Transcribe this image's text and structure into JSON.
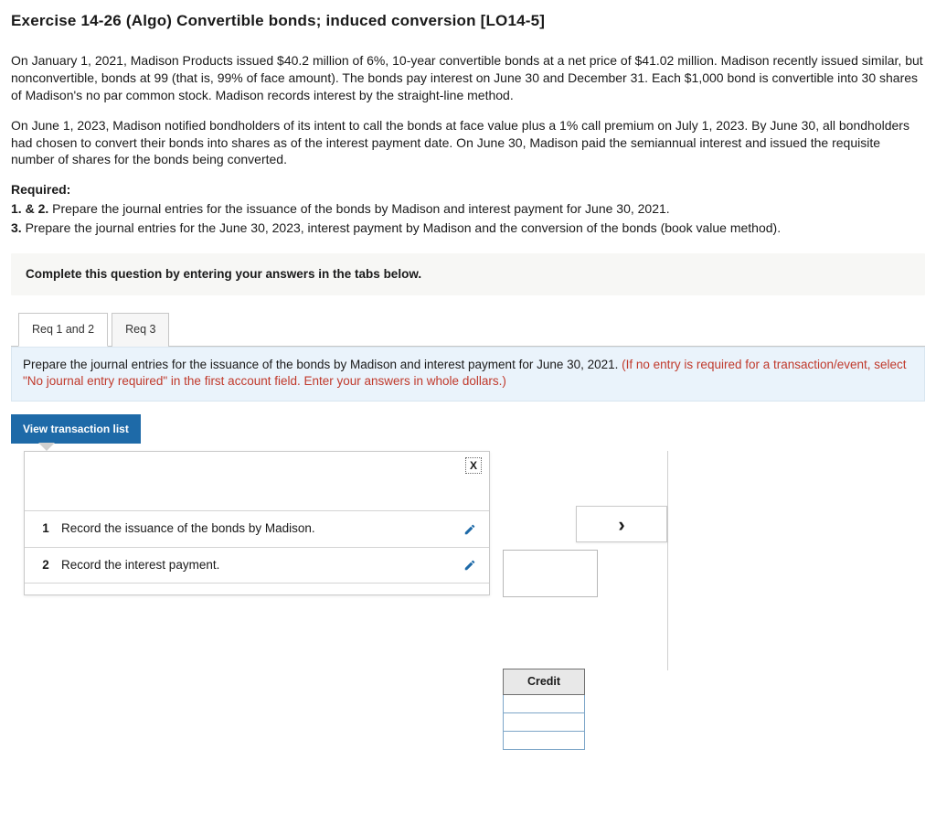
{
  "title": "Exercise 14-26 (Algo) Convertible bonds; induced conversion [LO14-5]",
  "para1": "On January 1, 2021, Madison Products issued $40.2 million of 6%, 10-year convertible bonds at a net price of $41.02 million. Madison recently issued similar, but nonconvertible, bonds at 99 (that is, 99% of face amount). The bonds pay interest on June 30 and December 31. Each $1,000 bond is convertible into 30 shares of Madison's no par common stock. Madison records interest by the straight-line method.",
  "para2": "On June 1, 2023, Madison notified bondholders of its intent to call the bonds at face value plus a 1% call premium on July 1, 2023. By June 30, all bondholders had chosen to convert their bonds into shares as of the interest payment date. On June 30, Madison paid the semiannual interest and issued the requisite number of shares for the bonds being converted.",
  "required": {
    "label": "Required:",
    "line1_prefix": "1. & 2. ",
    "line1_text": "Prepare the journal entries for the issuance of the bonds by Madison and interest payment for June 30, 2021.",
    "line2_prefix": "3. ",
    "line2_text": "Prepare the journal entries for the June 30, 2023, interest payment by Madison and the conversion of the bonds (book value method)."
  },
  "instruction_bar": "Complete this question by entering your answers in the tabs below.",
  "tabs": {
    "t1": "Req 1 and 2",
    "t2": "Req 3"
  },
  "tab_note": {
    "black": "Prepare the journal entries for the issuance of the bonds by Madison and interest payment for June 30, 2021. ",
    "red": "(If no entry is required for a transaction/event, select \"No journal entry required\" in the first account field. Enter your answers in whole dollars.)"
  },
  "view_btn": "View transaction list",
  "close_x": "X",
  "trans": [
    {
      "n": "1",
      "text": "Record the issuance of the bonds by Madison."
    },
    {
      "n": "2",
      "text": "Record the interest payment."
    }
  ],
  "next_arrow": "›",
  "credit_label": "Credit"
}
